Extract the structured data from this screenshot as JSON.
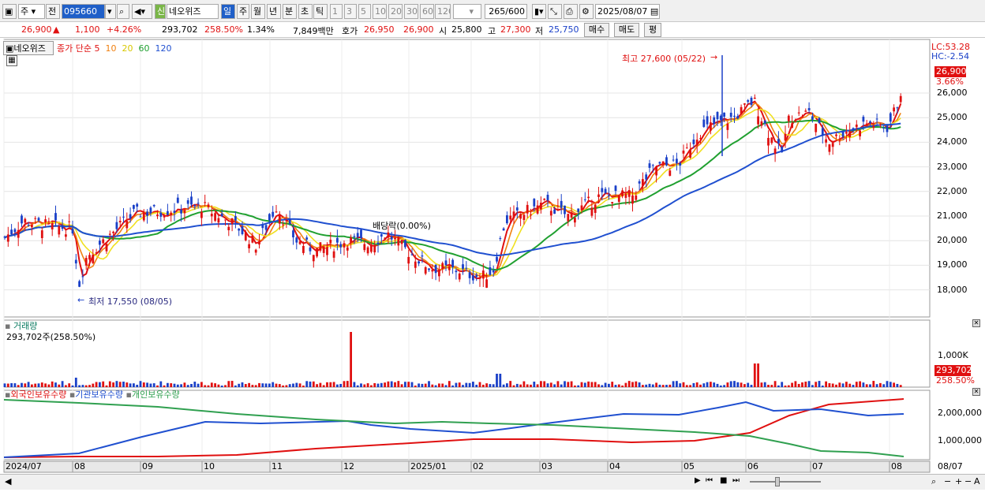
{
  "toolbar": {
    "type_label": "주",
    "prev_label": "전",
    "code": "095660",
    "name": "네오위즈",
    "name_badge": "신",
    "periods": [
      "일",
      "주",
      "월",
      "년",
      "분",
      "초",
      "틱"
    ],
    "intervals": [
      "1",
      "3",
      "5",
      "10",
      "20",
      "30",
      "60",
      "120"
    ],
    "count": "265",
    "count_total": "/600",
    "date": "2025/08/07"
  },
  "info": {
    "price": "26,900",
    "change": "1,100",
    "change_pct": "+4.26%",
    "volume": "293,702",
    "volume_ratio": "258.50%",
    "turnover": "1.34%",
    "amount": "7,849백만",
    "hoga_label": "호가",
    "ask": "26,950",
    "bid": "26,900",
    "open_label": "시",
    "open": "25,800",
    "high_label": "고",
    "high": "27,300",
    "low_label": "저",
    "low": "25,750",
    "buy_btn": "매수",
    "sell_btn": "매도",
    "eval_btn": "평"
  },
  "price_panel": {
    "name_tag": "네오위즈",
    "legend_title": "종가 단순",
    "ma_periods": [
      "5",
      "10",
      "20",
      "60",
      "120"
    ],
    "lc": "LC:53.28",
    "hc": "HC:-2.54",
    "last_price": "26,900",
    "last_pct": "3.66%",
    "high_annot": "최고 27,600 (05/22)",
    "low_annot": "최저 17,550 (08/05)",
    "dividend_annot": "배당락(0.00%)",
    "y_ticks": [
      "26,000",
      "25,000",
      "24,000",
      "23,000",
      "22,000",
      "21,000",
      "20,000",
      "19,000",
      "18,000"
    ]
  },
  "volume_panel": {
    "title": "거래량",
    "value_line": "293,702주(258.50%)",
    "y_tick": "1,000K",
    "last_value": "293,702",
    "last_pct": "258.50%"
  },
  "holding_panel": {
    "legend": [
      "외국인보유수량",
      "기관보유수량",
      "개인보유수량"
    ],
    "y_ticks": [
      "2,000,000",
      "1,000,000"
    ]
  },
  "x_axis": {
    "labels": [
      "2024/07",
      "08",
      "09",
      "10",
      "11",
      "12",
      "2025/01",
      "02",
      "03",
      "04",
      "05",
      "06",
      "07",
      "08"
    ],
    "right_label": "08/07"
  },
  "colors": {
    "up": "#e01010",
    "down": "#1a40c8",
    "ma5": "#e01010",
    "ma10": "#f08010",
    "ma20": "#f0e020",
    "ma60": "#20a030",
    "ma120": "#2050d0",
    "foreign": "#e01010",
    "institution": "#2050d0",
    "individual": "#30a050"
  }
}
